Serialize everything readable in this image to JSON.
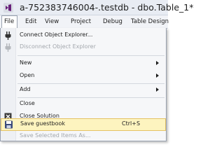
{
  "window": {
    "title": "a-752383746004-.testdb - dbo.Table_1*"
  },
  "menubar": {
    "items": [
      "File",
      "Edit",
      "View",
      "Project",
      "Debug",
      "Table Design"
    ]
  },
  "file_menu": {
    "connect": {
      "label": "Connect Object Explorer...",
      "icon": "plug-icon"
    },
    "disconnect": {
      "label": "Disconnect Object Explorer",
      "icon": "plug-disabled-icon"
    },
    "new": {
      "label": "New"
    },
    "open": {
      "label": "Open"
    },
    "add": {
      "label": "Add"
    },
    "close": {
      "label": "Close"
    },
    "close_solution": {
      "label": "Close Solution",
      "icon": "close-solution-icon"
    },
    "save": {
      "label": "Save guestbook",
      "shortcut": "Ctrl+S",
      "icon": "floppy-disk-icon"
    },
    "save_selected": {
      "label": "Save Selected Items As..."
    }
  },
  "colors": {
    "highlight_bg": "#fdf4bf",
    "highlight_border": "#e5c365",
    "accent": "#68217a"
  }
}
